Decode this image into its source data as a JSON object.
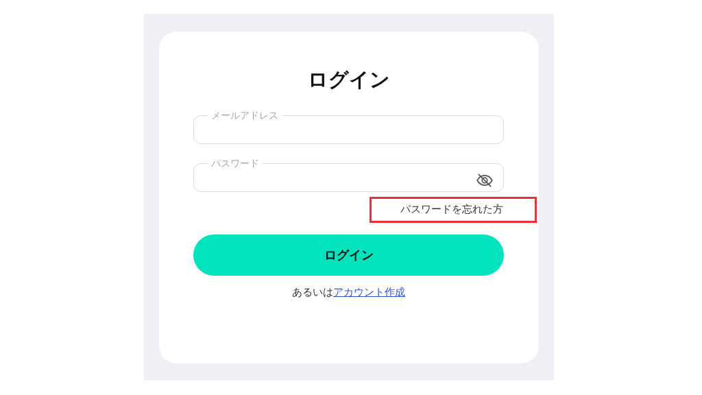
{
  "title": "ログイン",
  "fields": [
    {
      "kind": "email",
      "label": "メールアドレス"
    },
    {
      "kind": "password",
      "label": "パスワード"
    }
  ],
  "forgot_link": {
    "label": "パスワードを忘れた方",
    "highlighted": true
  },
  "submit_button": "ログイン",
  "signup": {
    "text": "あるいは",
    "link": "アカウント作成"
  }
}
